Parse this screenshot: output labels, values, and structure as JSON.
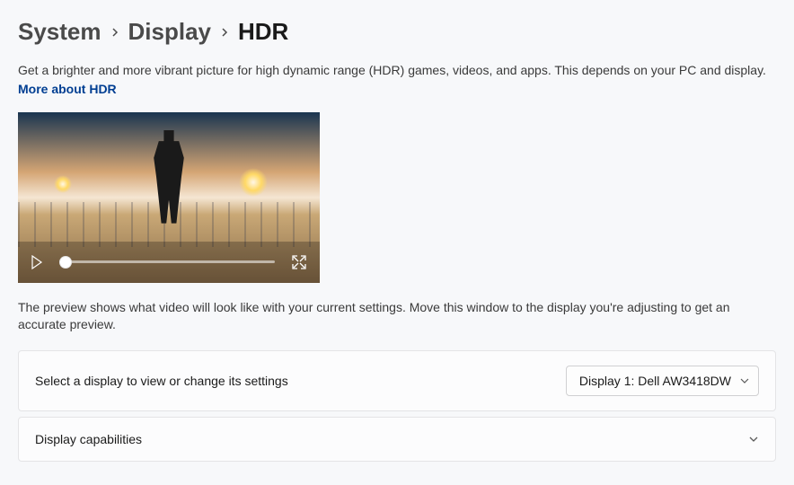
{
  "breadcrumb": {
    "items": [
      "System",
      "Display",
      "HDR"
    ]
  },
  "header": {
    "description": "Get a brighter and more vibrant picture for high dynamic range (HDR) games, videos, and apps. This depends on your PC and display.",
    "more_link": "More about HDR"
  },
  "preview": {
    "note": "The preview shows what video will look like with your current settings. Move this window to the display you're adjusting to get an accurate preview."
  },
  "settings": {
    "display_select": {
      "label": "Select a display to view or change its settings",
      "value": "Display 1: Dell AW3418DW"
    },
    "capabilities": {
      "label": "Display capabilities"
    }
  }
}
